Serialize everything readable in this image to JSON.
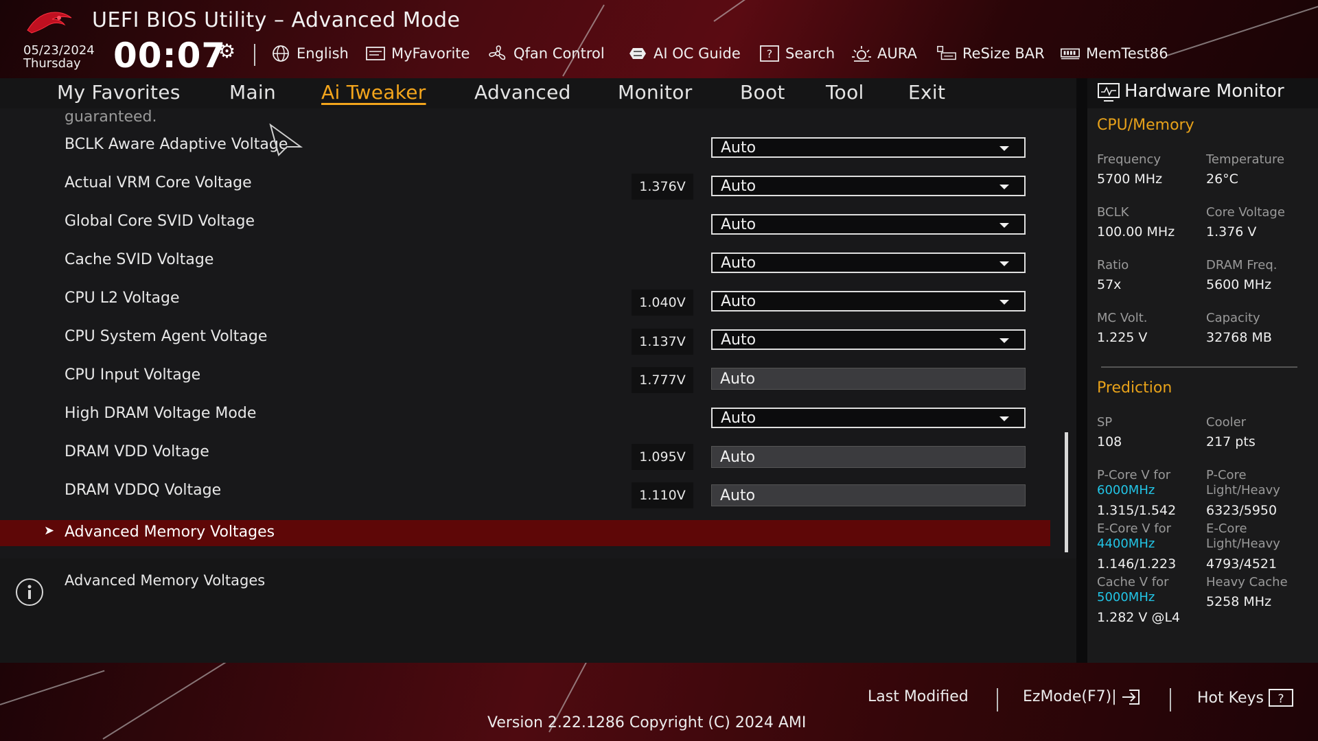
{
  "header": {
    "title": "UEFI BIOS Utility – Advanced Mode",
    "date": "05/23/2024",
    "day": "Thursday",
    "time": "00:07",
    "tools": [
      {
        "label": "English",
        "icon": "globe-icon"
      },
      {
        "label": "MyFavorite",
        "icon": "favorite-icon"
      },
      {
        "label": "Qfan Control",
        "icon": "fan-icon"
      },
      {
        "label": "AI OC Guide",
        "icon": "ai-oc-guide-icon"
      },
      {
        "label": "Search",
        "icon": "search-help-icon"
      },
      {
        "label": "AURA",
        "icon": "aura-icon"
      },
      {
        "label": "ReSize BAR",
        "icon": "resize-bar-icon"
      },
      {
        "label": "MemTest86",
        "icon": "memtest-icon"
      }
    ]
  },
  "tabs": [
    {
      "label": "My Favorites"
    },
    {
      "label": "Main"
    },
    {
      "label": "Ai Tweaker",
      "active": true
    },
    {
      "label": "Advanced"
    },
    {
      "label": "Monitor"
    },
    {
      "label": "Boot"
    },
    {
      "label": "Tool"
    },
    {
      "label": "Exit"
    }
  ],
  "settings": {
    "cut_text": "guaranteed.",
    "rows": [
      {
        "label": "BCLK Aware Adaptive Voltage",
        "value": "",
        "control": "dropdown",
        "option": "Auto"
      },
      {
        "label": "Actual VRM Core Voltage",
        "value": "1.376V",
        "control": "dropdown",
        "option": "Auto"
      },
      {
        "label": "Global Core SVID Voltage",
        "value": "",
        "control": "dropdown",
        "option": "Auto"
      },
      {
        "label": "Cache SVID Voltage",
        "value": "",
        "control": "dropdown",
        "option": "Auto"
      },
      {
        "label": "CPU L2 Voltage",
        "value": "1.040V",
        "control": "dropdown",
        "option": "Auto"
      },
      {
        "label": "CPU System Agent Voltage",
        "value": "1.137V",
        "control": "dropdown",
        "option": "Auto"
      },
      {
        "label": "CPU Input Voltage",
        "value": "1.777V",
        "control": "textbox",
        "option": "Auto"
      },
      {
        "label": "High DRAM Voltage Mode",
        "value": "",
        "control": "dropdown",
        "option": "Auto"
      },
      {
        "label": "DRAM VDD Voltage",
        "value": "1.095V",
        "control": "textbox",
        "option": "Auto"
      },
      {
        "label": "DRAM VDDQ Voltage",
        "value": "1.110V",
        "control": "textbox",
        "option": "Auto"
      }
    ],
    "selected_submenu": "Advanced Memory Voltages",
    "help_text": "Advanced Memory Voltages"
  },
  "hardware_monitor": {
    "title": "Hardware Monitor",
    "cpu_memory": {
      "heading": "CPU/Memory",
      "frequency_label": "Frequency",
      "frequency": "5700 MHz",
      "temperature_label": "Temperature",
      "temperature": "26°C",
      "bclk_label": "BCLK",
      "bclk": "100.00 MHz",
      "core_voltage_label": "Core Voltage",
      "core_voltage": "1.376 V",
      "ratio_label": "Ratio",
      "ratio": "57x",
      "dram_freq_label": "DRAM Freq.",
      "dram_freq": "5600 MHz",
      "mc_volt_label": "MC Volt.",
      "mc_volt": "1.225 V",
      "capacity_label": "Capacity",
      "capacity": "32768 MB"
    },
    "prediction": {
      "heading": "Prediction",
      "sp_label": "SP",
      "sp": "108",
      "cooler_label": "Cooler",
      "cooler": "217 pts",
      "pcore_v_label": "P-Core V for",
      "pcore_v_freq": "6000MHz",
      "pcore_v": "1.315/1.542",
      "pcore_lh_label1": "P-Core",
      "pcore_lh_label2": "Light/Heavy",
      "pcore_lh": "6323/5950",
      "ecore_v_label": "E-Core V for",
      "ecore_v_freq": "4400MHz",
      "ecore_v": "1.146/1.223",
      "ecore_lh_label1": "E-Core",
      "ecore_lh_label2": "Light/Heavy",
      "ecore_lh": "4793/4521",
      "cache_v_label": "Cache V for",
      "cache_v_freq": "5000MHz",
      "cache_v": "1.282 V @L4",
      "heavy_cache_label": "Heavy Cache",
      "heavy_cache": "5258 MHz"
    }
  },
  "footer": {
    "last_modified": "Last Modified",
    "ezmode": "EzMode(F7)|",
    "hot_keys": "Hot Keys",
    "version": "Version 2.22.1286 Copyright (C) 2024 AMI"
  },
  "colors": {
    "accent": "#f3a51c",
    "cyan": "#22c5e6",
    "selected_row": "#5e0707"
  }
}
